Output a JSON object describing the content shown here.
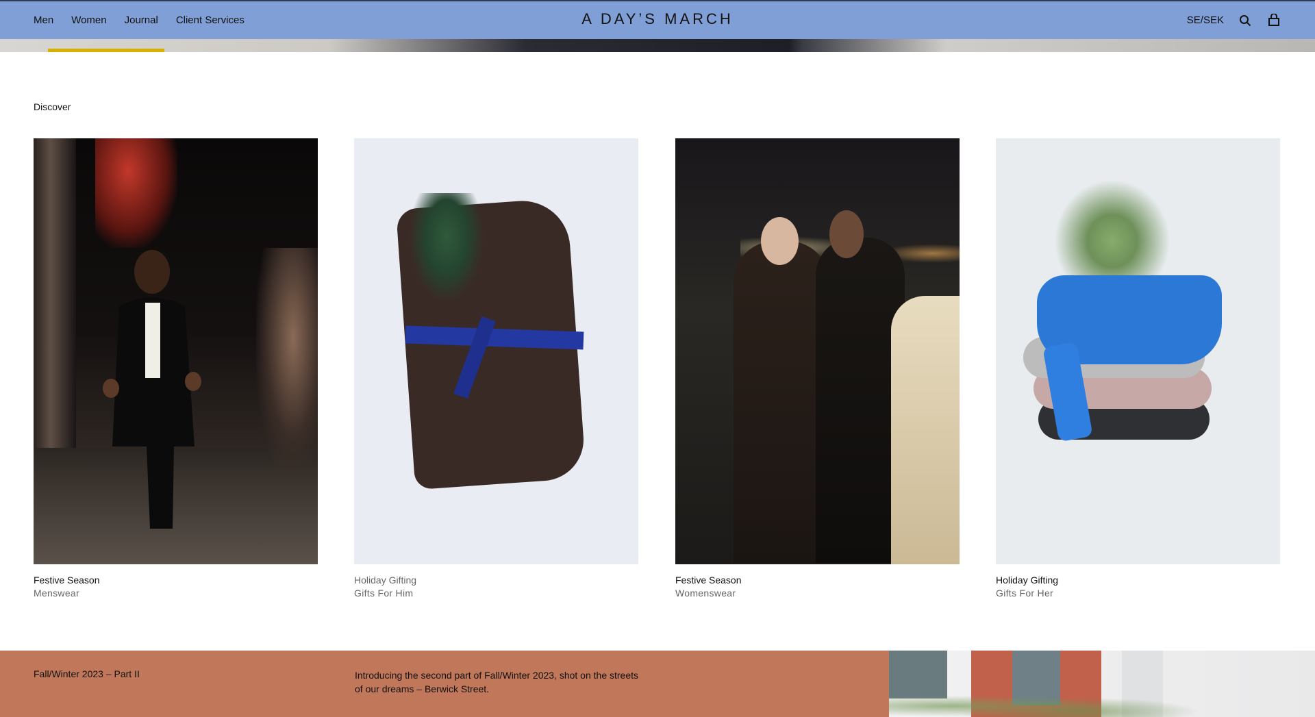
{
  "header": {
    "nav": [
      {
        "label": "Men"
      },
      {
        "label": "Women"
      },
      {
        "label": "Journal"
      },
      {
        "label": "Client Services"
      }
    ],
    "logo": "A DAY’S MARCH",
    "locale": "SE/SEK",
    "icons": {
      "search": "search-icon",
      "cart": "shopping-bag-icon"
    },
    "colors": {
      "bar": "#7f9fd6"
    }
  },
  "discover": {
    "section_label": "Discover",
    "cards": [
      {
        "title": "Festive Season",
        "subtitle": "Menswear",
        "image": "festive-menswear-photo"
      },
      {
        "title": "Holiday Gifting",
        "subtitle": "Gifts For Him",
        "image": "gifts-for-him-photo"
      },
      {
        "title": "Festive Season",
        "subtitle": "Womenswear",
        "image": "festive-womenswear-photo"
      },
      {
        "title": "Holiday Gifting",
        "subtitle": "Gifts For Her",
        "image": "gifts-for-her-photo"
      }
    ]
  },
  "banner": {
    "label": "Fall/Winter 2023 – Part II",
    "description": "Introducing the second part of Fall/Winter 2023, shot on the streets of our dreams – Berwick Street.",
    "color": "#c0775a"
  }
}
